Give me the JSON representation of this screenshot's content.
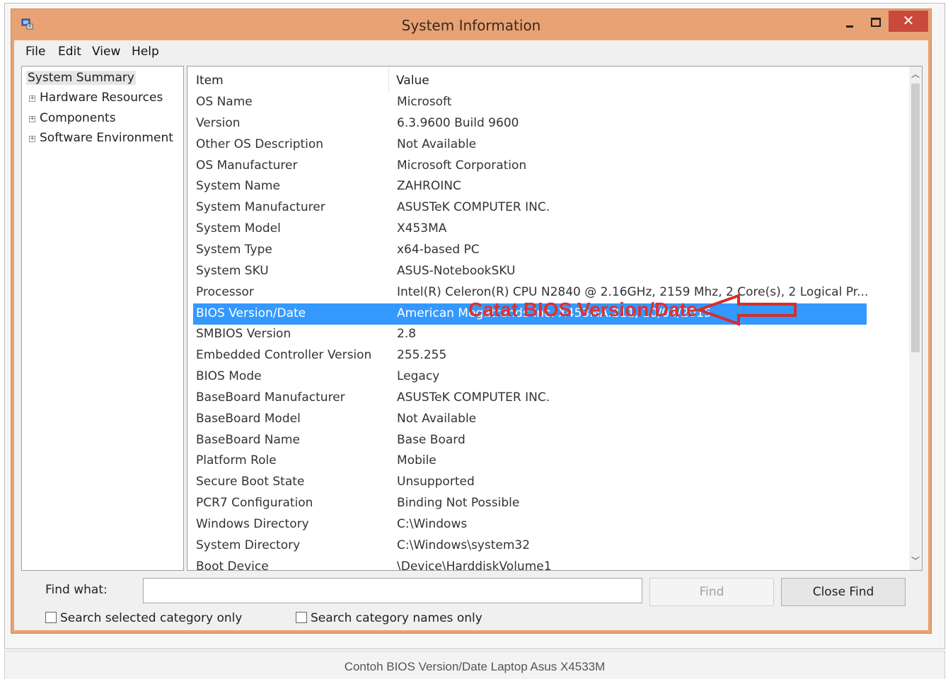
{
  "window": {
    "title": "System Information",
    "close_glyph": "✕"
  },
  "menu": [
    "File",
    "Edit",
    "View",
    "Help"
  ],
  "tree": {
    "root": "System Summary",
    "nodes": [
      "Hardware Resources",
      "Components",
      "Software Environment"
    ]
  },
  "table": {
    "headers": [
      "Item",
      "Value"
    ],
    "rows": [
      {
        "item": "OS Name",
        "value": "Microsoft"
      },
      {
        "item": "Version",
        "value": "6.3.9600 Build 9600"
      },
      {
        "item": "Other OS Description",
        "value": "Not Available"
      },
      {
        "item": "OS Manufacturer",
        "value": "Microsoft Corporation"
      },
      {
        "item": "System Name",
        "value": "ZAHROINC"
      },
      {
        "item": "System Manufacturer",
        "value": "ASUSTeK COMPUTER INC."
      },
      {
        "item": "System Model",
        "value": "X453MA"
      },
      {
        "item": "System Type",
        "value": "x64-based PC"
      },
      {
        "item": "System SKU",
        "value": "ASUS-NotebookSKU"
      },
      {
        "item": "Processor",
        "value": "Intel(R) Celeron(R) CPU  N2840  @ 2.16GHz, 2159 Mhz, 2 Core(s), 2 Logical Pr..."
      },
      {
        "item": "BIOS Version/Date",
        "value": "American Megatrends Inc. X453MA.211, 10/04/2015"
      },
      {
        "item": "SMBIOS Version",
        "value": "2.8"
      },
      {
        "item": "Embedded Controller Version",
        "value": "255.255"
      },
      {
        "item": "BIOS Mode",
        "value": "Legacy"
      },
      {
        "item": "BaseBoard Manufacturer",
        "value": "ASUSTeK COMPUTER INC."
      },
      {
        "item": "BaseBoard Model",
        "value": "Not Available"
      },
      {
        "item": "BaseBoard Name",
        "value": "Base Board"
      },
      {
        "item": "Platform Role",
        "value": "Mobile"
      },
      {
        "item": "Secure Boot State",
        "value": "Unsupported"
      },
      {
        "item": "PCR7 Configuration",
        "value": "Binding Not Possible"
      },
      {
        "item": "Windows Directory",
        "value": "C:\\Windows"
      },
      {
        "item": "System Directory",
        "value": "C:\\Windows\\system32"
      },
      {
        "item": "Boot Device",
        "value": "\\Device\\HarddiskVolume1"
      }
    ],
    "selected_row": "BIOS Version/Date"
  },
  "annotation": {
    "text": "Catat BIOS Version/Date",
    "color": "#e03030"
  },
  "find": {
    "label": "Find what:",
    "value": "",
    "find_button": "Find",
    "close_button": "Close Find",
    "option1": "Search selected category only",
    "option2": "Search category names only"
  },
  "caption": "Contoh BIOS Version/Date Laptop Asus X4533M",
  "colors": {
    "title_bar": "#e9a273",
    "selection": "#3399ff",
    "close_button": "#c94a3d"
  }
}
